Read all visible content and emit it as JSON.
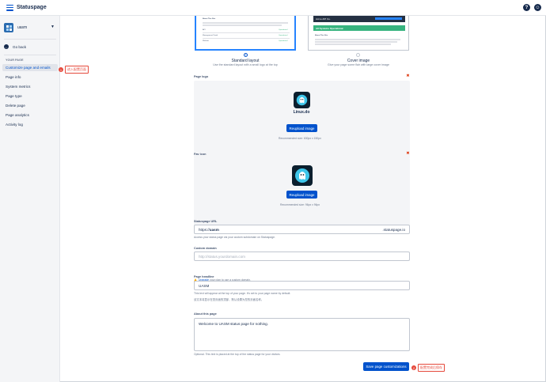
{
  "app": {
    "name": "Statuspage"
  },
  "topbar": {
    "help_glyph": "?",
    "user_glyph": "☺"
  },
  "sidebar": {
    "page_name": "uasm",
    "go_back": "Go back",
    "section_title": "YOUR PAGE",
    "items": [
      {
        "label": "Customize page and emails",
        "active": true
      },
      {
        "label": "Page info"
      },
      {
        "label": "System metrics"
      },
      {
        "label": "Page type"
      },
      {
        "label": "Delete page"
      },
      {
        "label": "Page analytics"
      },
      {
        "label": "Activity log"
      }
    ],
    "callout": {
      "number": "1",
      "text": "进入配置页面"
    }
  },
  "layouts": {
    "standard": {
      "title": "Standard layout",
      "desc": "Use the standard layout with a small logo at the top",
      "preview_title": "About This Site",
      "preview_rows": [
        {
          "name": "API",
          "status": "Operational"
        },
        {
          "name": "Management Portal",
          "status": "Operational"
        },
        {
          "name": "Website",
          "status": "Operational"
        }
      ]
    },
    "cover": {
      "title": "Cover image",
      "desc": "Give your page some flair with large cover image",
      "preview_brand": "Acme API Co.",
      "preview_ops": "All Systems Operational",
      "preview_about": "About This Site"
    }
  },
  "page_logo": {
    "label": "Page logo",
    "image_text": "Linux.do",
    "button": "Reupload image",
    "hint": "Recommended size: 630px x 150px"
  },
  "fav_icon": {
    "label": "Fav icon",
    "button": "Reupload image",
    "hint": "Recommended size: 96px x 96px"
  },
  "statuspage_url": {
    "label": "Statuspage URL",
    "prefix": "https://",
    "value": "uasm",
    "suffix": ".statuspage.io",
    "hint": "Access your status page via your custom subdomain on Statuspage."
  },
  "custom_domain": {
    "label": "Custom domain",
    "placeholder": "http://status.yourdomain.com",
    "warn_link": "Upgrade",
    "warn_text": "your plan to use a custom domain."
  },
  "page_headline": {
    "label": "Page headline",
    "value": "UASM",
    "hint1": "This text will appear at the top of your page. It's set to your page name by default.",
    "hint2": "该文本将显示在您页面的顶部，默认设置为您的页面名称。"
  },
  "about": {
    "label": "About this page",
    "value": "Welcome to UASM status page for nothing.",
    "hint": "Optional. This text is placed at the top of the status page for your visitors."
  },
  "save": {
    "button": "Save page customizations",
    "callout": {
      "number": "2",
      "text": "配置完成后保存"
    }
  },
  "colors": {
    "primary": "#0052cc",
    "accent": "#2684ff",
    "danger": "#e5483a",
    "green": "#36b37e"
  }
}
